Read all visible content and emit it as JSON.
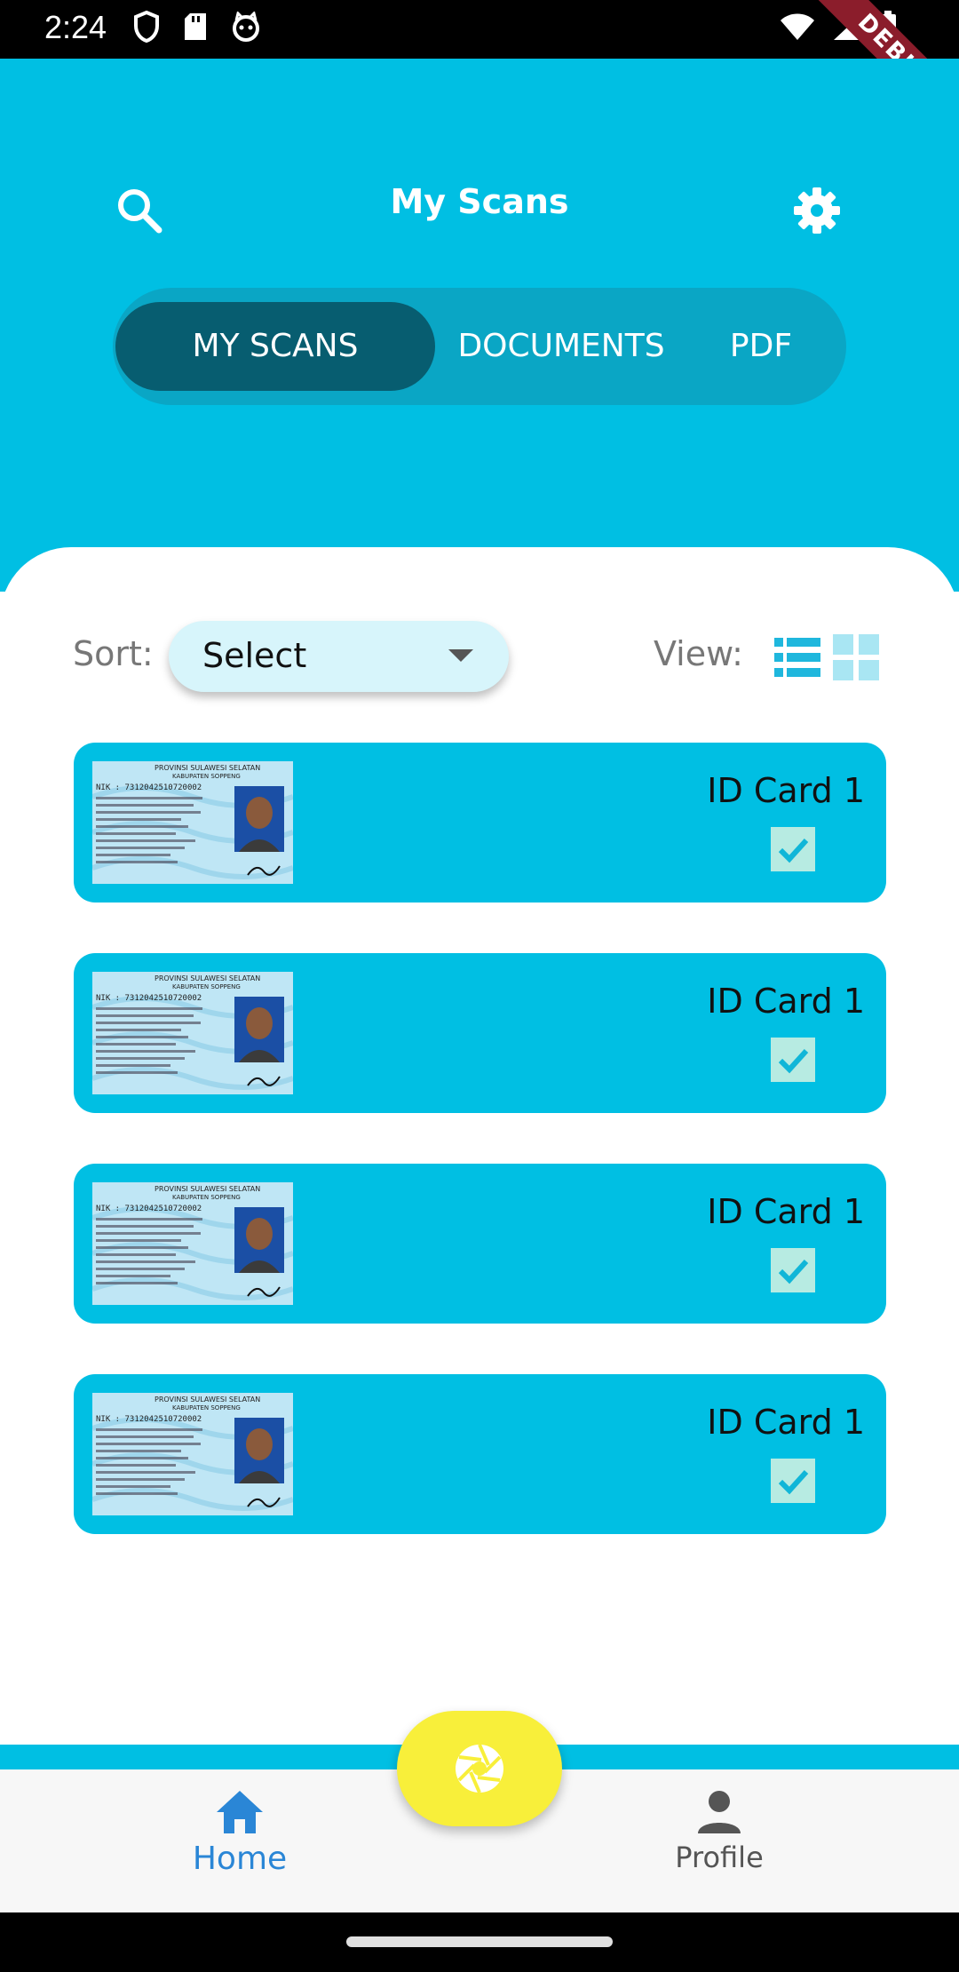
{
  "status_bar": {
    "time": "2:24",
    "left_icons": [
      "shield-icon",
      "sd-card-icon",
      "cat-icon"
    ],
    "right_icons": [
      "wifi-icon",
      "signal-icon",
      "battery-icon"
    ],
    "debug_label": "DEBUG"
  },
  "header": {
    "title": "My Scans",
    "search_icon": "search-icon",
    "settings_icon": "gear-icon"
  },
  "tabs": [
    {
      "label": "MY SCANS",
      "active": true
    },
    {
      "label": "DOCUMENTS",
      "active": false
    },
    {
      "label": "PDF",
      "active": false
    }
  ],
  "controls": {
    "sort_label": "Sort:",
    "sort_value": "Select",
    "view_label": "View:"
  },
  "items": [
    {
      "title": "ID Card 1",
      "checked": true
    },
    {
      "title": "ID Card 1",
      "checked": true
    },
    {
      "title": "ID Card 1",
      "checked": true
    },
    {
      "title": "ID Card 1",
      "checked": true
    }
  ],
  "id_card_thumb": {
    "province": "PROVINSI SULAWESI SELATAN",
    "regency": "KABUPATEN SOPPENG",
    "nik": "NIK : 7312042510720002"
  },
  "bottom_nav": {
    "home_label": "Home",
    "profile_label": "Profile",
    "fab_icon": "camera-shutter-icon"
  },
  "colors": {
    "primary": "#00bfe3",
    "tab_active": "#075d70",
    "fab": "#f8ef3a",
    "home_active": "#2a86d6"
  }
}
